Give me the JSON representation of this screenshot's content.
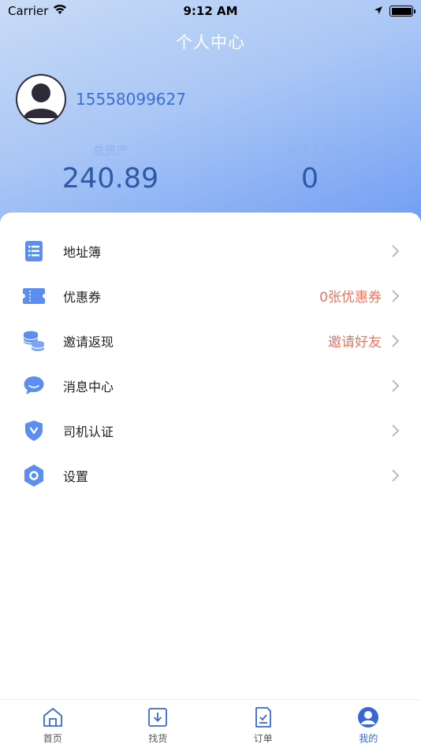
{
  "status_bar": {
    "carrier": "Carrier",
    "time": "9:12 AM"
  },
  "header": {
    "title": "个人中心",
    "phone": "15558099627",
    "stats": [
      {
        "label": "总资产",
        "value": "240.89"
      },
      {
        "label": "邀请人数",
        "value": "0"
      }
    ]
  },
  "menu": [
    {
      "label": "地址簿",
      "icon": "address-book-icon",
      "extra": ""
    },
    {
      "label": "优惠券",
      "icon": "coupon-icon",
      "extra": "0张优惠券"
    },
    {
      "label": "邀请返现",
      "icon": "coins-icon",
      "extra": "邀请好友"
    },
    {
      "label": "消息中心",
      "icon": "message-icon",
      "extra": ""
    },
    {
      "label": "司机认证",
      "icon": "shield-icon",
      "extra": ""
    },
    {
      "label": "设置",
      "icon": "settings-icon",
      "extra": ""
    }
  ],
  "tabs": [
    {
      "label": "首页",
      "icon": "home-icon"
    },
    {
      "label": "找货",
      "icon": "download-box-icon"
    },
    {
      "label": "订单",
      "icon": "order-icon"
    },
    {
      "label": "我的",
      "icon": "profile-icon",
      "active": true
    }
  ],
  "colors": {
    "accent": "#3a67d8",
    "icon_blue": "#5b8ef0",
    "highlight": "#f0735a"
  }
}
